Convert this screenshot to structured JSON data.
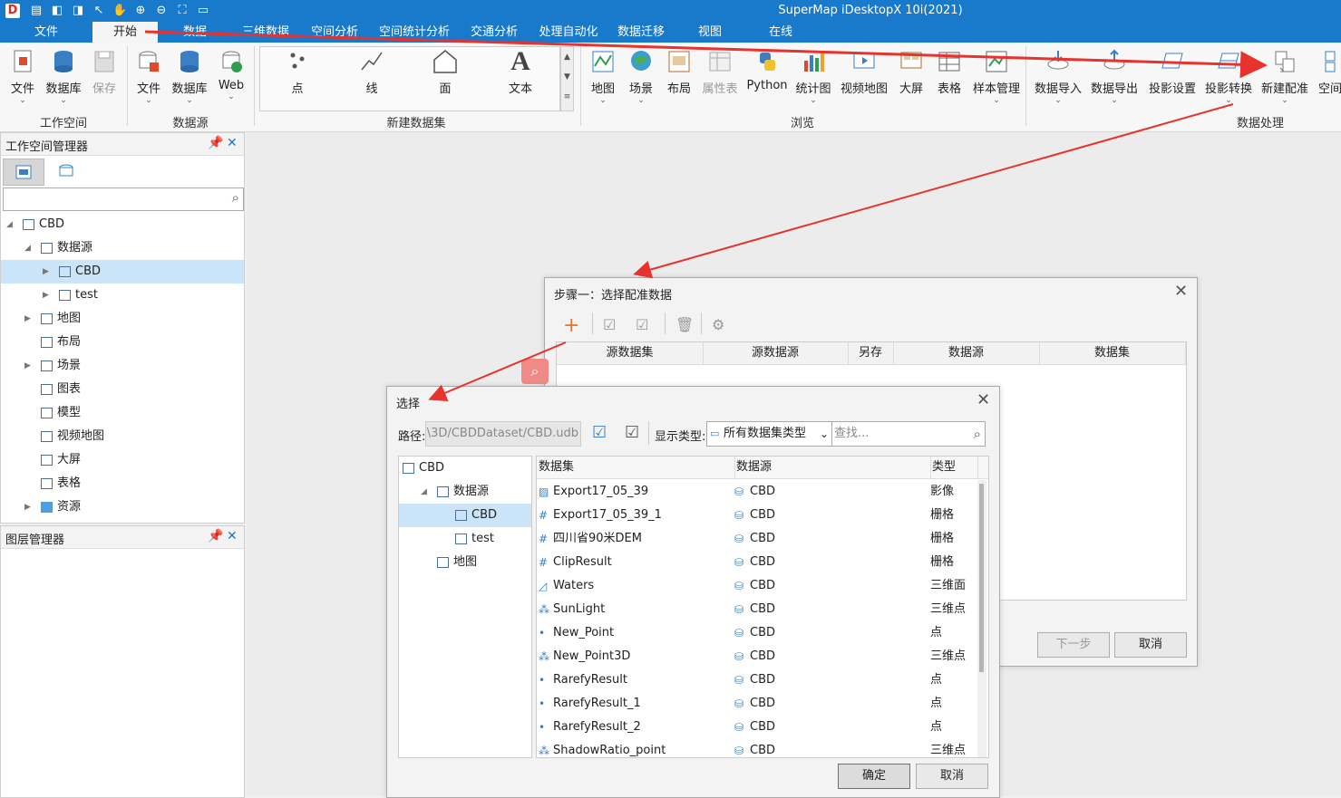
{
  "app": {
    "title": "SuperMap iDesktopX 10i(2021)"
  },
  "menu": {
    "tabs": [
      "文件",
      "开始",
      "数据",
      "三维数据",
      "空间分析",
      "空间统计分析",
      "交通分析",
      "处理自动化",
      "数据迁移",
      "视图",
      "在线"
    ],
    "active": "开始"
  },
  "ribbon": {
    "workspace": {
      "buttons": [
        "文件",
        "数据库",
        "保存"
      ],
      "group": "工作空间"
    },
    "datasource": {
      "buttons": [
        "文件",
        "数据库",
        "Web"
      ],
      "group": "数据源"
    },
    "new_dataset": {
      "buttons": [
        "点",
        "线",
        "面",
        "文本"
      ],
      "group": "新建数据集"
    },
    "browse": {
      "buttons": [
        "地图",
        "场景",
        "布局",
        "属性表",
        "Python",
        "统计图",
        "视频地图",
        "大屏",
        "表格",
        "样本管理"
      ],
      "group": "浏览"
    },
    "data_processing": {
      "buttons": [
        "数据导入",
        "数据导出",
        "投影设置",
        "投影转换",
        "新建配准",
        "空间"
      ],
      "group": "数据处理"
    }
  },
  "workspace_panel": {
    "title": "工作空间管理器",
    "search_placeholder": "",
    "tree": [
      {
        "label": "CBD",
        "expander": "◢"
      },
      {
        "label": "数据源",
        "expander": "◢"
      },
      {
        "label": "CBD",
        "expander": "▶",
        "selected": true
      },
      {
        "label": "test",
        "expander": "▶"
      },
      {
        "label": "地图",
        "expander": "▶"
      },
      {
        "label": "布局",
        "expander": ""
      },
      {
        "label": "场景",
        "expander": "▶"
      },
      {
        "label": "图表",
        "expander": ""
      },
      {
        "label": "模型",
        "expander": ""
      },
      {
        "label": "视频地图",
        "expander": ""
      },
      {
        "label": "大屏",
        "expander": ""
      },
      {
        "label": "表格",
        "expander": ""
      },
      {
        "label": "资源",
        "expander": "▶"
      }
    ]
  },
  "layer_panel": {
    "title": "图层管理器"
  },
  "step_dialog": {
    "title": "步骤一：选择配准数据",
    "columns": [
      "源数据集",
      "源数据源",
      "另存",
      "数据源",
      "数据集"
    ],
    "next_label": "下一步",
    "cancel_label": "取消"
  },
  "select_dialog": {
    "title": "选择",
    "path_label": "路径:",
    "path_value": "\\3D/CBDDataset/CBD.udb",
    "type_label": "显示类型:",
    "type_value": "所有数据集类型",
    "search_placeholder": "查找...",
    "tree": [
      {
        "label": "CBD",
        "expander": ""
      },
      {
        "label": "数据源",
        "expander": "◢"
      },
      {
        "label": "CBD",
        "expander": "",
        "selected": true
      },
      {
        "label": "test",
        "expander": ""
      },
      {
        "label": "地图",
        "expander": ""
      }
    ],
    "columns": [
      "数据集",
      "数据源",
      "类型"
    ],
    "rows": [
      {
        "name": "Export17_05_39",
        "source": "CBD",
        "type": "影像",
        "icon": "image-icon"
      },
      {
        "name": "Export17_05_39_1",
        "source": "CBD",
        "type": "栅格",
        "icon": "grid-icon"
      },
      {
        "name": "四川省90米DEM",
        "source": "CBD",
        "type": "栅格",
        "icon": "grid-icon"
      },
      {
        "name": "ClipResult",
        "source": "CBD",
        "type": "栅格",
        "icon": "grid-icon"
      },
      {
        "name": "Waters",
        "source": "CBD",
        "type": "三维面",
        "icon": "region3d-icon"
      },
      {
        "name": "SunLight",
        "source": "CBD",
        "type": "三维点",
        "icon": "point3d-icon"
      },
      {
        "name": "New_Point",
        "source": "CBD",
        "type": "点",
        "icon": "point-icon"
      },
      {
        "name": "New_Point3D",
        "source": "CBD",
        "type": "三维点",
        "icon": "point3d-icon"
      },
      {
        "name": "RarefyResult",
        "source": "CBD",
        "type": "点",
        "icon": "point-icon"
      },
      {
        "name": "RarefyResult_1",
        "source": "CBD",
        "type": "点",
        "icon": "point-icon"
      },
      {
        "name": "RarefyResult_2",
        "source": "CBD",
        "type": "点",
        "icon": "point-icon"
      },
      {
        "name": "ShadowRatio_point",
        "source": "CBD",
        "type": "三维点",
        "icon": "point3d-icon"
      }
    ],
    "ok_label": "确定",
    "cancel_label": "取消"
  },
  "colors": {
    "accent": "#1979ca",
    "annotation_arrow": "#e8322e",
    "selection": "#cce4f7"
  }
}
